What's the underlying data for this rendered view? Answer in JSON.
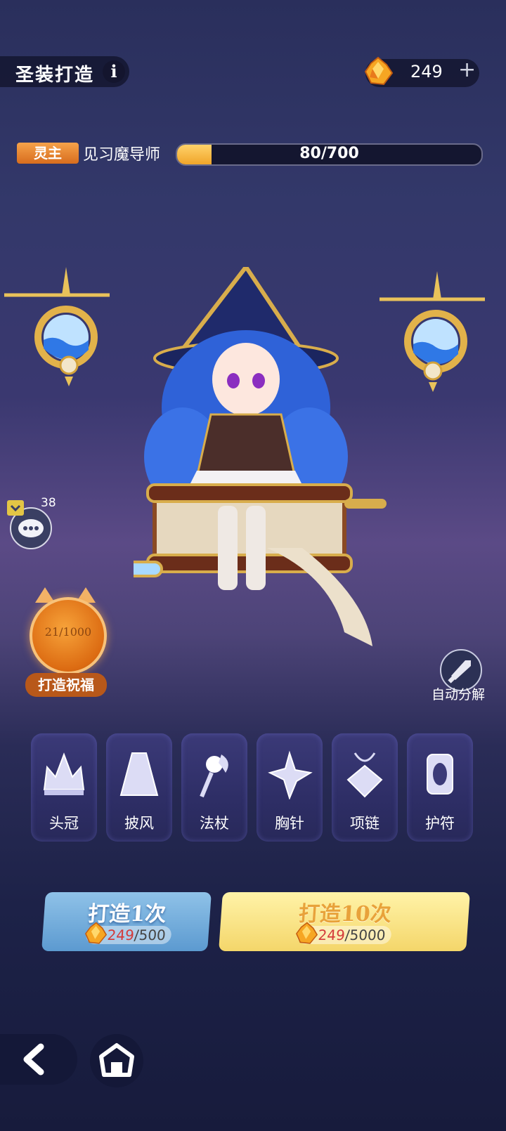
{
  "header": {
    "title": "圣装打造",
    "info_label": "i",
    "currency": {
      "icon": "gem-crystal-icon",
      "amount": "249",
      "add_label": "+"
    }
  },
  "level": {
    "badge": "灵主",
    "title": "见习魔导师",
    "progress_text": "80/700",
    "progress_value": 80,
    "progress_max": 700
  },
  "chat": {
    "count": "38"
  },
  "blessing": {
    "count": "21/1000",
    "label": "打造祝福"
  },
  "auto_decompose": {
    "label": "自动分解"
  },
  "slots": [
    {
      "label": "头冠",
      "icon": "crown-icon"
    },
    {
      "label": "披风",
      "icon": "cape-icon"
    },
    {
      "label": "法杖",
      "icon": "staff-icon"
    },
    {
      "label": "胸针",
      "icon": "brooch-icon"
    },
    {
      "label": "项链",
      "icon": "necklace-icon"
    },
    {
      "label": "护符",
      "icon": "amulet-icon"
    }
  ],
  "forge_once": {
    "title": "打造1次",
    "cost_owned": "249",
    "cost_sep_total": "/500"
  },
  "forge_ten": {
    "title": "打造10次",
    "cost_owned": "249",
    "cost_sep_total": "/5000"
  },
  "colors": {
    "accent_orange": "#e58a2e",
    "progress_fill": "#f0a52a",
    "cost_red": "#d43a3a"
  }
}
